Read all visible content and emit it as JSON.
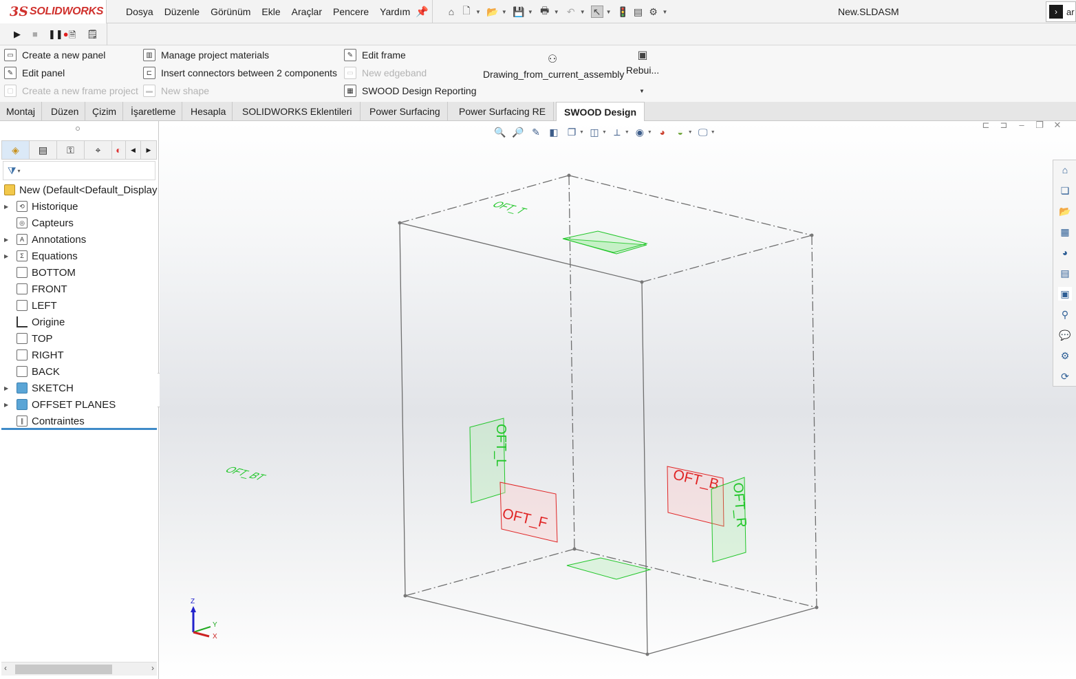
{
  "app": {
    "logo_ds": "3S",
    "logo_name": "SOLIDWORKS",
    "document_title": "New.SLDASM",
    "cmd_label": "ar"
  },
  "menu": [
    "Dosya",
    "Düzenle",
    "Görünüm",
    "Ekle",
    "Araçlar",
    "Pencere",
    "Yardım"
  ],
  "ribbon": {
    "create_panel": "Create a new panel",
    "edit_panel": "Edit panel",
    "create_frame_project": "Create a new frame project",
    "manage_materials": "Manage project materials",
    "insert_connectors": "Insert connectors between 2 components",
    "new_shape": "New shape",
    "edit_frame": "Edit frame",
    "new_edgeband": "New edgeband",
    "design_reporting": "SWOOD Design Reporting",
    "drawing_from_assembly": "Drawing_from_current_assembly",
    "rebuild": "Rebui..."
  },
  "tabs": [
    "Montaj",
    "Düzen",
    "Çizim",
    "İşaretleme",
    "Hesapla",
    "SOLIDWORKS Eklentileri",
    "Power Surfacing",
    "Power Surfacing RE",
    "SWOOD Design"
  ],
  "active_tab": "SWOOD Design",
  "tree": {
    "root": "New  (Default<Default_Display",
    "items": [
      {
        "label": "Historique",
        "icon": "history-icon",
        "expandable": true
      },
      {
        "label": "Capteurs",
        "icon": "sensor-icon",
        "expandable": false
      },
      {
        "label": "Annotations",
        "icon": "annotation-icon",
        "expandable": true
      },
      {
        "label": "Equations",
        "icon": "equation-icon",
        "expandable": true
      },
      {
        "label": "BOTTOM",
        "icon": "plane-icon",
        "expandable": false
      },
      {
        "label": "FRONT",
        "icon": "plane-icon",
        "expandable": false
      },
      {
        "label": "LEFT",
        "icon": "plane-icon",
        "expandable": false
      },
      {
        "label": "Origine",
        "icon": "origin-icon",
        "expandable": false
      },
      {
        "label": "TOP",
        "icon": "plane-icon",
        "expandable": false
      },
      {
        "label": "RIGHT",
        "icon": "plane-icon",
        "expandable": false
      },
      {
        "label": "BACK",
        "icon": "plane-icon",
        "expandable": false
      },
      {
        "label": "SKETCH",
        "icon": "folder-icon",
        "expandable": true
      },
      {
        "label": "OFFSET PLANES",
        "icon": "folder-icon",
        "expandable": true
      },
      {
        "label": "Contraintes",
        "icon": "mates-icon",
        "expandable": false
      }
    ]
  },
  "model_labels": {
    "top": "OFT_T",
    "bottom": "OFT_BT",
    "left": "OFT_L",
    "front": "OFT_F",
    "back": "OFT_B",
    "right": "OFT_R"
  },
  "triad": {
    "z": "Z",
    "y": "Y",
    "x": "X"
  },
  "colors": {
    "green_plane": "#22c62a",
    "red_plane": "#e02424",
    "accent": "#3f8bc8"
  }
}
